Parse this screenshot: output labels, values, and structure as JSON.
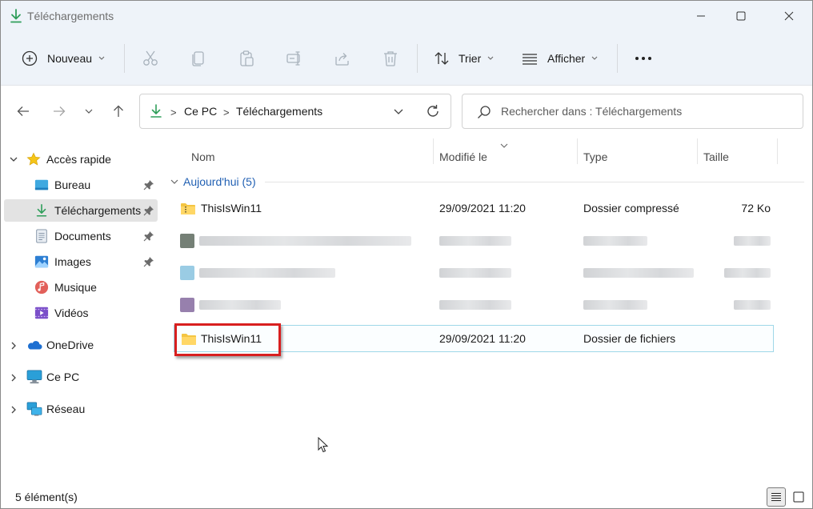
{
  "window": {
    "title": "Téléchargements"
  },
  "commandbar": {
    "new_label": "Nouveau",
    "sort_label": "Trier",
    "view_label": "Afficher"
  },
  "address": {
    "segments": [
      "Ce PC",
      "Téléchargements"
    ]
  },
  "search": {
    "placeholder": "Rechercher dans : Téléchargements"
  },
  "sidebar": {
    "items": [
      {
        "label": "Accès rapide"
      },
      {
        "label": "Bureau"
      },
      {
        "label": "Téléchargements"
      },
      {
        "label": "Documents"
      },
      {
        "label": "Images"
      },
      {
        "label": "Musique"
      },
      {
        "label": "Vidéos"
      },
      {
        "label": "OneDrive"
      },
      {
        "label": "Ce PC"
      },
      {
        "label": "Réseau"
      }
    ]
  },
  "filelist": {
    "columns": [
      "Nom",
      "Modifié le",
      "Type",
      "Taille"
    ],
    "group_label": "Aujourd'hui (5)",
    "rows": [
      {
        "name": "ThisIsWin11",
        "date": "29/09/2021 11:20",
        "type": "Dossier compressé",
        "size": "72 Ko"
      },
      {
        "name": "ThisIsWin11",
        "date": "29/09/2021 11:20",
        "type": "Dossier de fichiers",
        "size": ""
      }
    ]
  },
  "statusbar": {
    "count": "5 élément(s)"
  },
  "colors": {
    "accent": "#2f9e5a",
    "highlight_border": "#d81f1f",
    "group_label": "#2160b3"
  }
}
